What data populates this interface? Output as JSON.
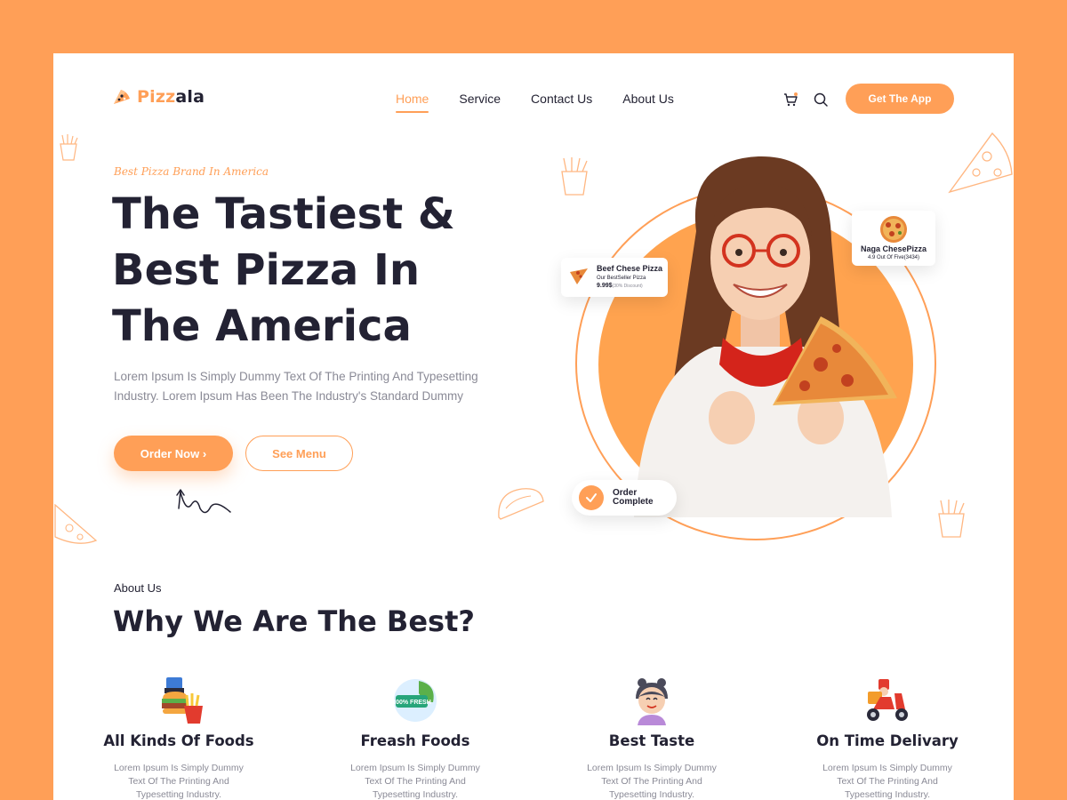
{
  "brand": {
    "name_part1": "Pizz",
    "name_part2": "ala",
    "accent": "#FF9F57",
    "dark": "#232233"
  },
  "nav": [
    {
      "label": "Home",
      "active": true
    },
    {
      "label": "Service",
      "active": false
    },
    {
      "label": "Contact Us",
      "active": false
    },
    {
      "label": "About Us",
      "active": false
    }
  ],
  "header": {
    "cart_icon": "cart-icon",
    "search_icon": "search-icon",
    "cta_label": "Get The App"
  },
  "hero": {
    "tagline": "Best Pizza Brand In America",
    "title": "The Tastiest & Best Pizza In The America",
    "description": "Lorem Ipsum Is Simply Dummy Text Of The Printing And Typesetting Industry. Lorem Ipsum Has Been The Industry's Standard Dummy",
    "order_button": "Order Now",
    "menu_button": "See Menu"
  },
  "cards": {
    "beef": {
      "title": "Beef Chese Pizza",
      "subtitle": "Our BestSeller Pizza",
      "price": "9.99$",
      "discount": "(30% Discount)"
    },
    "naga": {
      "title": "Naga ChesePizza",
      "rating": "4.9 Out Of Five(3434)"
    },
    "order": {
      "label": "Order Complete"
    }
  },
  "about": {
    "label": "About Us",
    "title": "Why We Are The Best?",
    "features": [
      {
        "title": "All Kinds Of Foods",
        "desc": "Lorem Ipsum Is Simply Dummy Text Of The Printing And Typesetting Industry.",
        "icon": "fast-food-icon"
      },
      {
        "title": "Freash Foods",
        "desc": "Lorem Ipsum Is Simply Dummy Text Of The Printing And Typesetting Industry.",
        "icon": "fresh-food-icon",
        "badge": "100% FRESH"
      },
      {
        "title": "Best Taste",
        "desc": "Lorem Ipsum Is Simply Dummy Text Of The Printing And Typesetting Industry.",
        "icon": "chef-girl-icon"
      },
      {
        "title": "On Time Delivary",
        "desc": "Lorem Ipsum Is Simply Dummy Text Of The Printing And Typesetting Industry.",
        "icon": "delivery-scooter-icon"
      }
    ]
  }
}
